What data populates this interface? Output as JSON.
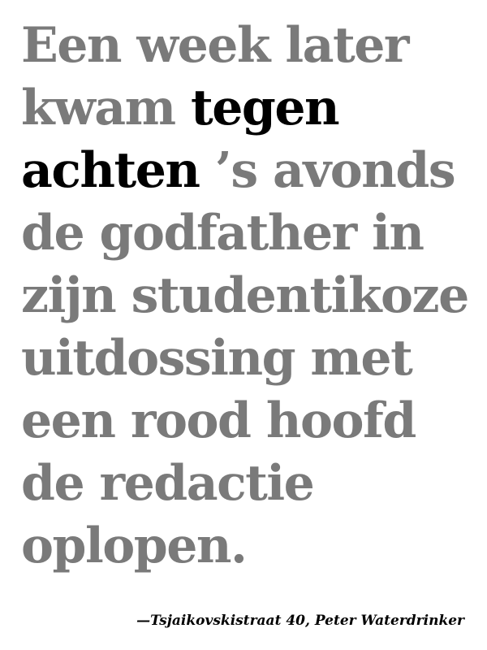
{
  "colors": {
    "background": "#ffffff",
    "quote_text": "#7a7a7a",
    "highlight_text": "#000000",
    "attribution_text": "#000000"
  },
  "quote": {
    "line1": "Een week later",
    "line2_before": "kwam ",
    "line2_highlight": "tegen",
    "line3_highlight": "achten",
    "line3_after": " ’s avonds",
    "line4": "de godfather in",
    "line5": "zijn studentikoze",
    "line6": "uitdossing met",
    "line7": "een rood hoofd",
    "line8": "de redactie",
    "line9": "oplopen."
  },
  "attribution": {
    "text": "—Tsjaikovskistraat 40, Peter Waterdrinker"
  }
}
